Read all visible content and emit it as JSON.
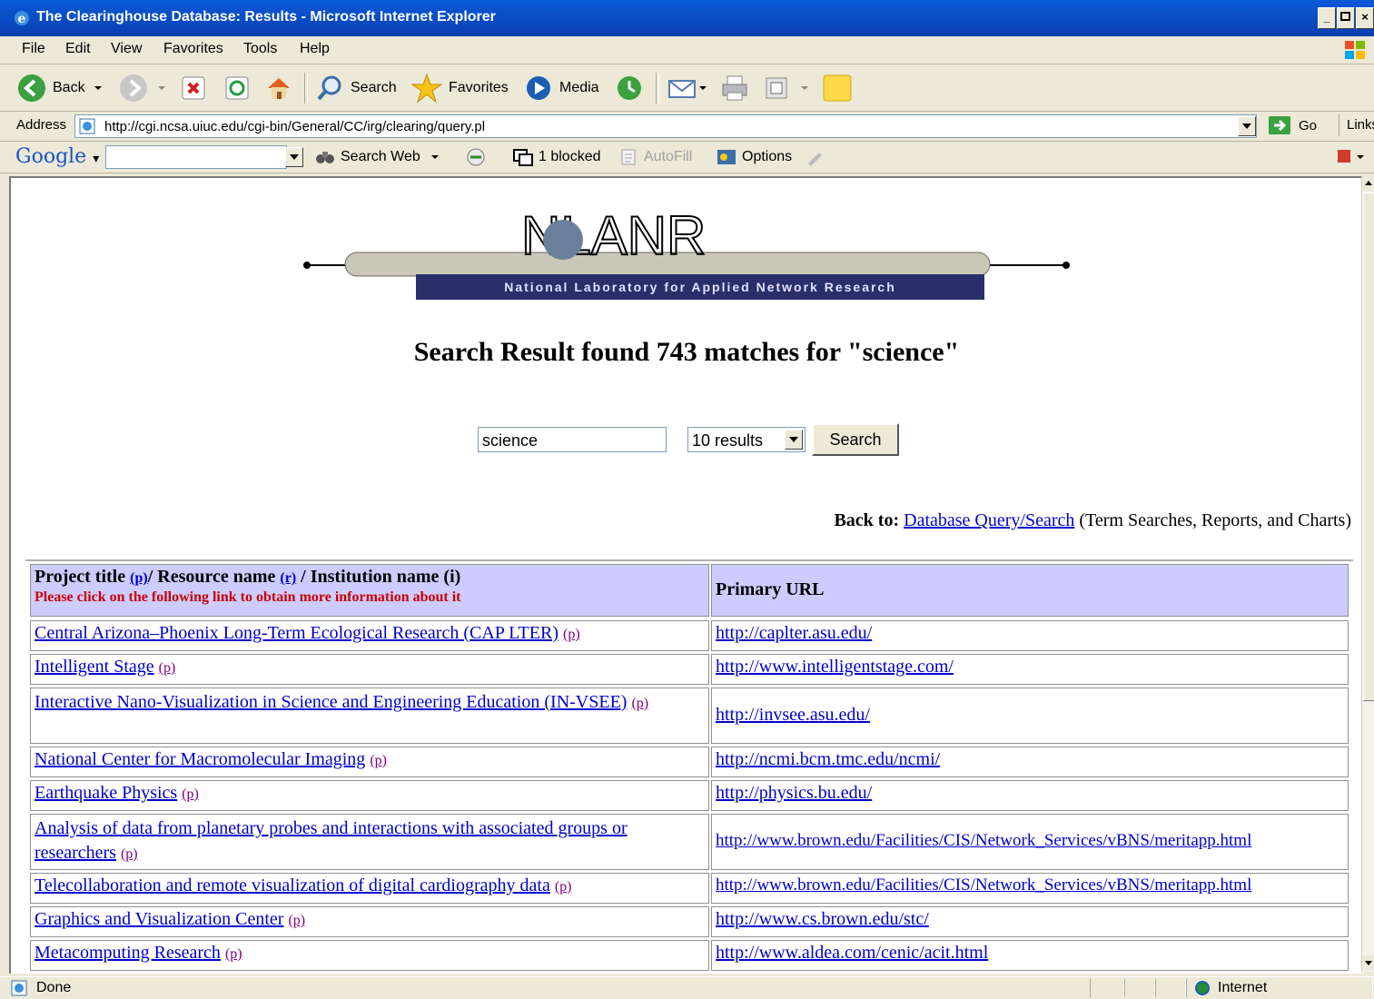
{
  "window": {
    "title": "The Clearinghouse Database: Results - Microsoft Internet Explorer",
    "controls": [
      "_",
      "×"
    ]
  },
  "menu": [
    "File",
    "Edit",
    "View",
    "Favorites",
    "Tools",
    "Help"
  ],
  "toolbar": {
    "back": "Back",
    "search": "Search",
    "favorites": "Favorites",
    "media": "Media"
  },
  "address": {
    "label": "Address",
    "url": "http://cgi.ncsa.uiuc.edu/cgi-bin/General/CC/irg/clearing/query.pl",
    "go": "Go",
    "links": "Links"
  },
  "google_bar": {
    "logo": "Google",
    "search_web": "Search Web",
    "blocked": "1 blocked",
    "autofill": "AutoFill",
    "options": "Options"
  },
  "banner": {
    "logo_text": "NLANR",
    "subtitle": "National Laboratory for Applied Network Research"
  },
  "page": {
    "headline": "Search Result found 743 matches for \"science\"",
    "search_value": "science",
    "results_option": "10 results",
    "search_button": "Search",
    "back_to_label": "Back to:",
    "back_to_link": "Database Query/Search",
    "back_to_note": "(Term Searches, Reports, and Charts)"
  },
  "table": {
    "header": {
      "project_title": "Project title",
      "p_link": "(p)",
      "resource_name": "/ Resource name",
      "r_link": "(r)",
      "institution": "/ Institution name (i)",
      "notice": "Please click on the following link to obtain more information about it",
      "url_header": "Primary URL"
    },
    "rows": [
      {
        "title": "Central Arizona–Phoenix Long-Term Ecological Research (CAP LTER)",
        "tag": "(p)",
        "url": "http://caplter.asu.edu/"
      },
      {
        "title": "Intelligent Stage",
        "tag": "(p)",
        "url": "http://www.intelligentstage.com/"
      },
      {
        "title": "Interactive Nano-Visualization in Science and Engineering Education (IN-VSEE)",
        "tag": "(p)",
        "url": "http://invsee.asu.edu/"
      },
      {
        "title": "National Center for Macromolecular Imaging",
        "tag": "(p)",
        "url": "http://ncmi.bcm.tmc.edu/ncmi/"
      },
      {
        "title": "Earthquake Physics",
        "tag": "(p)",
        "url": "http://physics.bu.edu/"
      },
      {
        "title": "Analysis of data from planetary probes and interactions with associated groups or researchers",
        "tag": "(p)",
        "url": "http://www.brown.edu/Facilities/CIS/Network_Services/vBNS/meritapp.html"
      },
      {
        "title": "Telecollaboration and remote visualization of digital cardiography data",
        "tag": "(p)",
        "url": "http://www.brown.edu/Facilities/CIS/Network_Services/vBNS/meritapp.html"
      },
      {
        "title": "Graphics and Visualization Center",
        "tag": "(p)",
        "url": "http://www.cs.brown.edu/stc/"
      },
      {
        "title": "Metacomputing Research",
        "tag": "(p)",
        "url": "http://www.aldea.com/cenic/acit.html"
      }
    ]
  },
  "status": {
    "left": "Done",
    "zone": "Internet"
  },
  "colors": {
    "header_bg": "#ccccff",
    "notice": "#cc0000",
    "link": "#0000cc",
    "visited_tag": "#800080"
  }
}
